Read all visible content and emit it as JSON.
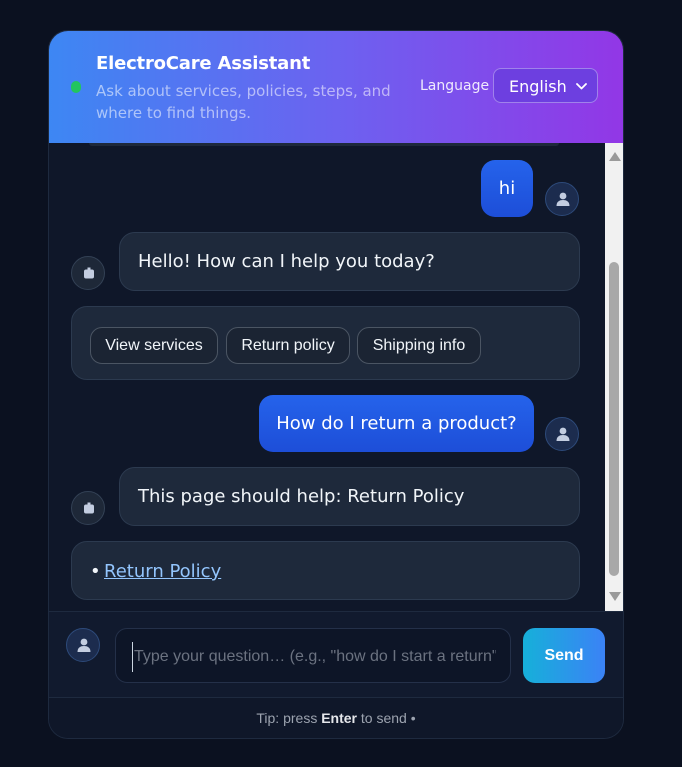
{
  "header": {
    "title": "ElectroCare Assistant",
    "subtitle": "Ask about services, policies, steps, and where to find things.",
    "language_label": "Language",
    "language_value": "English"
  },
  "messages": [
    {
      "role": "user",
      "text": "hi"
    },
    {
      "role": "bot",
      "text": "Hello! How can I help you today?"
    },
    {
      "role": "bot-chips",
      "chips": [
        "View services",
        "Return policy",
        "Shipping info"
      ]
    },
    {
      "role": "user",
      "text": "How do I return a product?"
    },
    {
      "role": "bot",
      "text": "This page should help: Return Policy"
    },
    {
      "role": "bot-links",
      "bullet": "•",
      "links": [
        "Return Policy"
      ]
    }
  ],
  "composer": {
    "placeholder": "Type your question… (e.g., \"how do I start a return\")",
    "send_label": "Send"
  },
  "footer": {
    "tip_prefix": "Tip: press",
    "tip_key": "Enter",
    "tip_suffix": "to send •"
  },
  "colors": {
    "header_gradient_start": "#3d87f3",
    "header_gradient_end": "#9237e6",
    "status_online": "#22c55e",
    "user_bubble": "#2563eb",
    "link": "#93c5fd"
  },
  "icons": {
    "user_avatar": "person-icon",
    "bot_avatar": "robot-icon",
    "language_dropdown": "chevron-down-icon"
  }
}
